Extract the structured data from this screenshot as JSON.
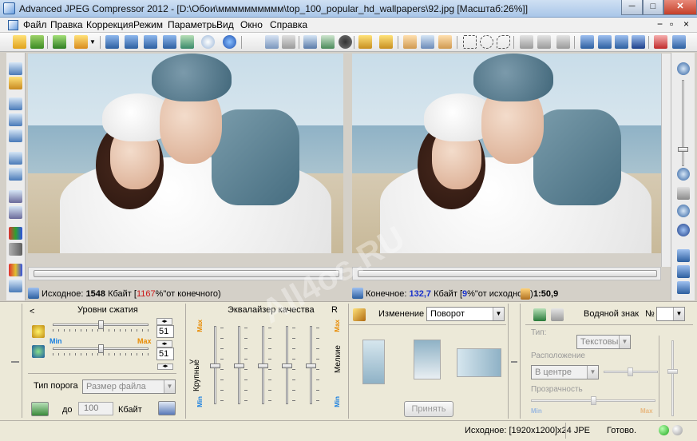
{
  "window": {
    "title": "Advanced JPEG Compressor 2012 - [D:\\Обои\\мммммммммм\\top_100_popular_hd_wallpapers\\92.jpg  [Масштаб:26%]]",
    "min_label": "─",
    "max_label": "□",
    "close_label": "✕"
  },
  "menu": [
    "Файл",
    "Правка",
    "Коррекция",
    "Режим",
    "Параметры",
    "Вид",
    "Окно",
    "Справка"
  ],
  "menu_right": [
    "−",
    "▫",
    "×"
  ],
  "status_left": {
    "label": "Исходное:",
    "size": "1548",
    "unit": "Кбайт",
    "pct_open": "[",
    "pct": "1167",
    "pct_text": "%\"от конечного)"
  },
  "status_right": {
    "label": "Конечное:",
    "size": "132,7",
    "unit": "Кбайт",
    "pct_open": "[",
    "pct": "9",
    "pct_text": "%\"от исходного)",
    "ratio": "1:50,9"
  },
  "compression": {
    "header": "Уровни сжатия",
    "collapse": "<",
    "value1": "51",
    "value2": "51",
    "min_label": "Min",
    "max_label": "Max",
    "threshold_label": "Тип порога",
    "threshold_value": "Размер файла",
    "to_label": "до",
    "to_value": "100",
    "unit": "Кбайт"
  },
  "equalizer": {
    "header": "Эквалайзер качества",
    "r_label": "R",
    "left_caption": "Крупные",
    "right_caption": "Мелкие",
    "arrow": ">",
    "max_label": "Max",
    "min_label": "Min"
  },
  "transform": {
    "label": "Изменение",
    "value": "Поворот",
    "apply_label": "Принять"
  },
  "watermark_panel": {
    "header": "Водяной знак",
    "no_label": "№",
    "type_label": "Тип:",
    "type_value": "Текстовый",
    "position_label": "Расположение",
    "position_value": "В центре",
    "transparency_label": "Прозрачность",
    "min_label": "Min",
    "max_label": "Max"
  },
  "image_watermark": "All4os.RU",
  "bottom_status": {
    "source": "Исходное: [1920x1200]x24 JPE",
    "ready": "Готово."
  },
  "colors": {
    "accent": "#1a33cc",
    "alert": "#cc1a1a",
    "max": "#e88a00",
    "min": "#1a80e0"
  }
}
